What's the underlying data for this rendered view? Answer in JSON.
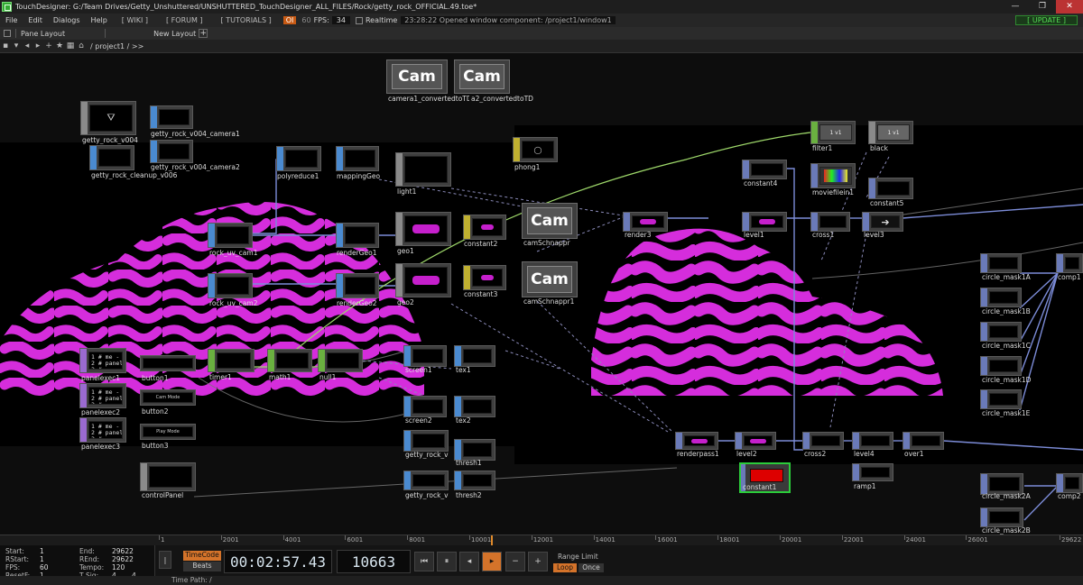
{
  "window": {
    "title": "TouchDesigner: G:/Team Drives/Getty_Unshuttered/UNSHUTTERED_TouchDesigner_ALL_FILES/Rock/getty_rock_OFFICIAL.49.toe*",
    "minimize": "—",
    "maximize": "❐",
    "close": "✕"
  },
  "menu": {
    "items": [
      "File",
      "Edit",
      "Dialogs",
      "Help"
    ],
    "wiki": "[ WIKI ]",
    "forum": "[ FORUM ]",
    "tutorials": "[ TUTORIALS ]",
    "oi": "OI",
    "sixty": "60",
    "fps_label": "FPS:",
    "fps_value": "34",
    "realtime": "Realtime",
    "message": "23:28:22 Opened window component: /project1/window1",
    "update": "[ UPDATE ]"
  },
  "panebar": {
    "pane_layout": "Pane Layout",
    "new_layout": "New Layout",
    "plus": "+"
  },
  "pathbar": {
    "path": "/ project1 / >>"
  },
  "nodes": {
    "camera1": "camera1_convertedtoTD",
    "camera2": "a2_convertedtoTD",
    "cam_text": "Cam",
    "getty_rock_v004": "getty_rock_v004",
    "getty_rock_v004_camera1": "getty_rock_v004_camera1",
    "getty_rock_cleanup": "getty_rock_cleanup_v006",
    "getty_rock_v004_camera2": "getty_rock_v004_camera2",
    "polyreduce1": "polyreduce1",
    "mappingGeo": "mappingGeo",
    "light1": "light1",
    "phong1": "phong1",
    "rock_uv_cam1": "rock_uv_cam1",
    "rock_uv_cam2": "rock_uv_cam2",
    "renderGeo1": "renderGeo1",
    "renderGeo2": "renderGeo2",
    "geo1": "geo1",
    "geo2": "geo2",
    "constant2": "constant2",
    "constant3": "constant3",
    "camSchnappr": "camSchnappr",
    "camSchnappr1": "camSchnappr1",
    "render3": "render3",
    "level1": "level1",
    "constant4": "constant4",
    "filter1": "filter1",
    "black": "black",
    "black_v1": "1 v1",
    "filter_v1": "1 v1",
    "moviefilein1": "moviefilein1",
    "constant5": "constant5",
    "cross1": "cross1",
    "level3": "level3",
    "circle_mask1A": "circle_mask1A",
    "circle_mask1B": "circle_mask1B",
    "circle_mask1C": "circle_mask1C",
    "circle_mask1D": "circle_mask1D",
    "circle_mask1E": "circle_mask1E",
    "comp1": "comp1",
    "panelexec1": "panelexec1",
    "panelexec2": "panelexec2",
    "panelexec3": "panelexec3",
    "panelexec_text": "1 # me -\n2 # panel\n3 #",
    "button1": "button1",
    "button2": "button2",
    "button3": "button3",
    "button_text": "Cam Mode",
    "button3_text": "Play Mode",
    "timer1": "timer1",
    "math1": "math1",
    "null1": "null1",
    "screen1": "screen1",
    "tex1": "tex1",
    "screen2": "screen2",
    "tex2": "tex2",
    "getty_rock_v_a": "getty_rock_v",
    "thresh1": "thresh1",
    "getty_rock_v_b": "getty_rock_v",
    "thresh2": "thresh2",
    "controlPanel": "controlPanel",
    "renderpass1": "renderpass1",
    "level2": "level2",
    "cross2": "cross2",
    "level4": "level4",
    "over1": "over1",
    "constant1": "constant1",
    "ramp1": "ramp1",
    "circle_mask2A": "circle_mask2A",
    "circle_mask2B": "circle_mask2B",
    "comp2": "comp2"
  },
  "timeline": {
    "ticks": [
      "1",
      "2001",
      "4001",
      "6001",
      "8001",
      "10001",
      "12001",
      "14001",
      "16001",
      "18001",
      "20001",
      "22001",
      "24001",
      "26001",
      "29622"
    ]
  },
  "info": {
    "start_label": "Start:",
    "start": "1",
    "end_label": "End:",
    "end": "29622",
    "rstart_label": "RStart:",
    "rstart": "1",
    "rend_label": "REnd:",
    "rend": "29622",
    "fps_label": "FPS:",
    "fps": "60",
    "tempo_label": "Tempo:",
    "tempo": "120",
    "resetf_label": "ResetF:",
    "resetf": "1",
    "tsig_label": "T Sig:",
    "tsig1": "4",
    "tsig2": "4"
  },
  "transport": {
    "timecode": "TimeCode",
    "beats": "Beats",
    "timecode_value": "00:02:57.43",
    "frame": "10663",
    "range_limit": "Range Limit",
    "loop": "Loop",
    "once": "Once",
    "time_path": "Time Path: /"
  }
}
